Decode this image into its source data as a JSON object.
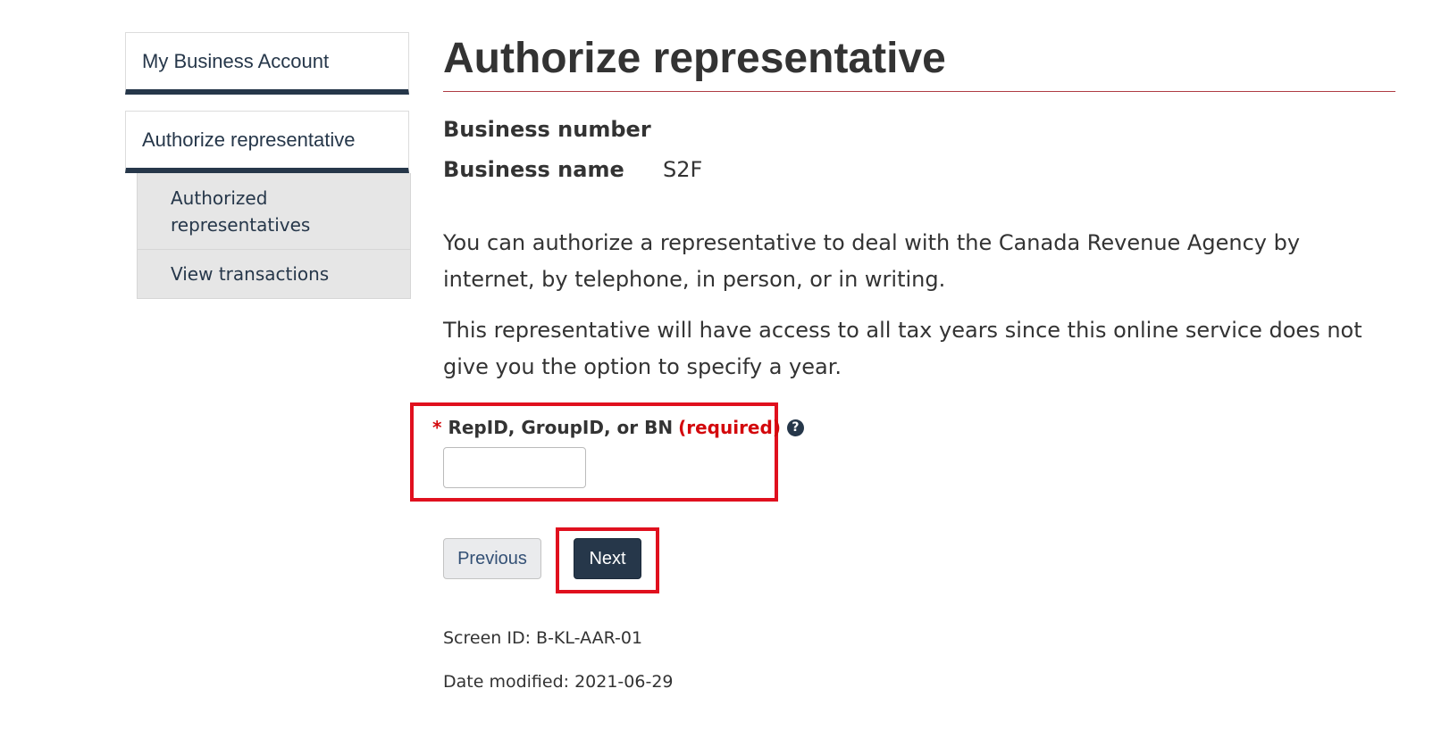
{
  "sidebar": {
    "account_heading": "My Business Account",
    "section_heading": "Authorize representative",
    "items": [
      {
        "label": "Authorized representatives"
      },
      {
        "label": "View transactions"
      }
    ]
  },
  "main": {
    "title": "Authorize representative",
    "business_number_label": "Business number",
    "business_number_value": "",
    "business_name_label": "Business name",
    "business_name_value": "S2F",
    "paragraph1": "You can authorize a representative to deal with the Canada Revenue Agency by internet, by telephone, in person, or in writing.",
    "paragraph2": "This representative will have access to all tax years since this online service does not give you the option to specify a year."
  },
  "form": {
    "required_star": "*",
    "field_label": "RepID, GroupID, or BN",
    "required_text": "(required)",
    "help_icon": "question-circle-icon",
    "input_value": ""
  },
  "buttons": {
    "previous": "Previous",
    "next": "Next"
  },
  "footer": {
    "screen_id": "Screen ID: B-KL-AAR-01",
    "date_modified": "Date modified: 2021-06-29"
  },
  "colors": {
    "navy": "#26374a",
    "title_rule": "#af3c43",
    "required_red": "#d3080c",
    "highlight_red": "#e0101e"
  }
}
